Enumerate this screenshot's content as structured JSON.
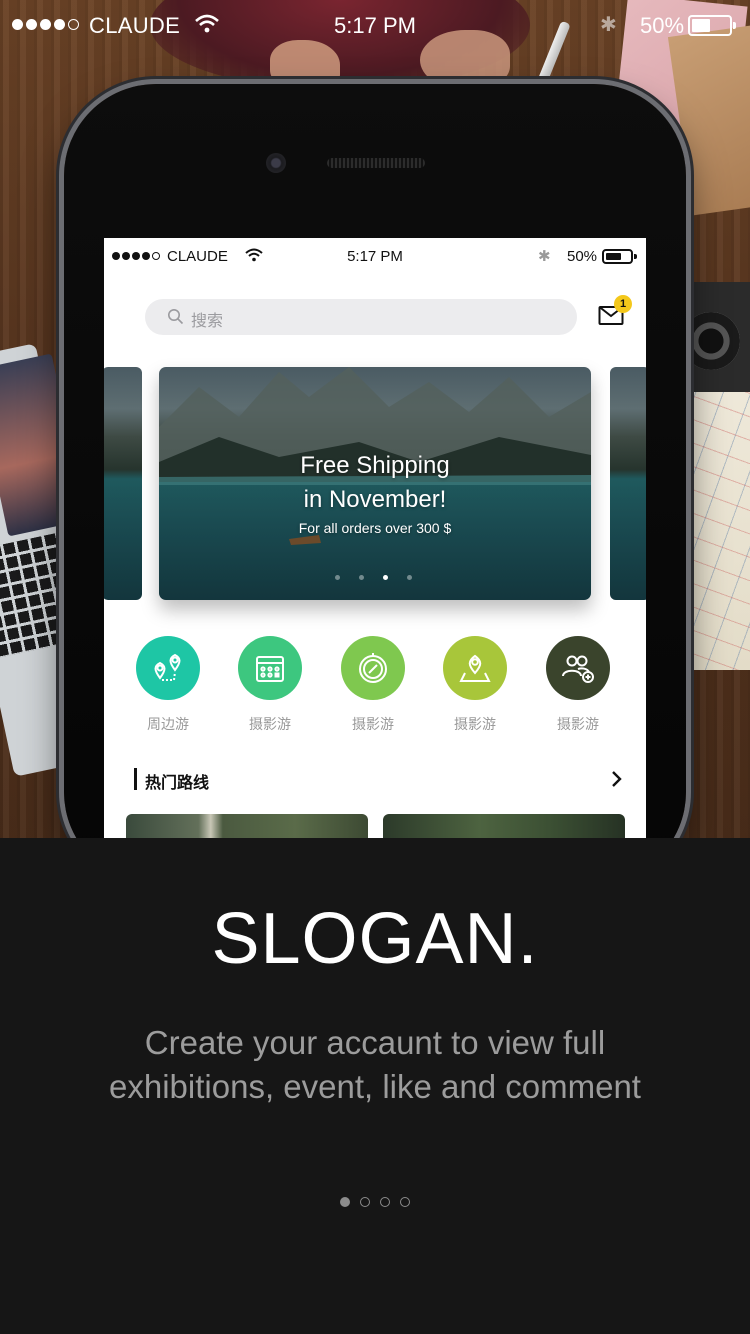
{
  "outer_status": {
    "carrier": "CLAUDE",
    "time": "5:17 PM",
    "battery": "50%",
    "battery_level": 0.5,
    "signal_bars": 4
  },
  "app": {
    "status": {
      "carrier": "CLAUDE",
      "time": "5:17 PM",
      "battery": "50%",
      "battery_level": 0.5,
      "signal_bars": 4
    },
    "search": {
      "placeholder": "搜索",
      "icon": "search-icon"
    },
    "mail": {
      "icon": "mail-icon",
      "badge_count": "1",
      "badge_color": "#f4c81b"
    },
    "banner": {
      "title_line1": "Free Shipping",
      "title_line2": "in November!",
      "subtitle": "For all orders over 300 $",
      "slide_count": 4,
      "active_slide": 3
    },
    "categories": [
      {
        "label": "周边游",
        "icon": "map-pins-icon",
        "color": "#1ec6a5"
      },
      {
        "label": "摄影游",
        "icon": "calendar-icon",
        "color": "#3dc77f"
      },
      {
        "label": "摄影游",
        "icon": "compass-icon",
        "color": "#7fc84f"
      },
      {
        "label": "摄影游",
        "icon": "location-map-icon",
        "color": "#a8c63a"
      },
      {
        "label": "摄影游",
        "icon": "add-users-icon",
        "color": "#3a442c"
      }
    ],
    "section": {
      "title": "热门路线",
      "icon": "chevron-right-icon"
    }
  },
  "onboarding": {
    "slogan": "SLOGAN.",
    "tagline_line1": "Create your accaunt to view full",
    "tagline_line2": "exhibitions, event, like and comment",
    "page_count": 4,
    "active_page": 1
  },
  "colors": {
    "background_dark": "#161616",
    "tagline": "#9c9c9c",
    "accent_badge": "#f4c81b"
  }
}
